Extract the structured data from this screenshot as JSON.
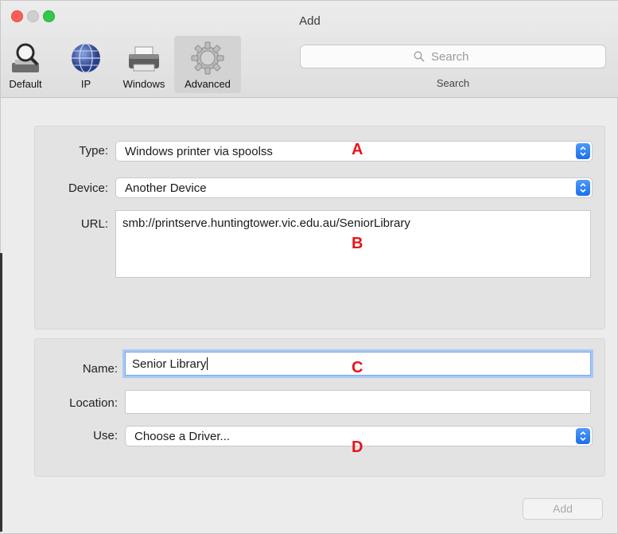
{
  "window": {
    "title": "Add"
  },
  "toolbar": {
    "tools": [
      {
        "label": "Default",
        "icon": "magnifier-printer-icon"
      },
      {
        "label": "IP",
        "icon": "globe-icon"
      },
      {
        "label": "Windows",
        "icon": "printer-icon"
      },
      {
        "label": "Advanced",
        "icon": "gear-icon",
        "selected": true
      }
    ],
    "search": {
      "placeholder": "Search",
      "label": "Search"
    }
  },
  "advanced": {
    "type": {
      "label": "Type:",
      "value": "Windows printer via spoolss"
    },
    "device": {
      "label": "Device:",
      "value": "Another Device"
    },
    "url": {
      "label": "URL:",
      "value": "smb://printserve.huntingtower.vic.edu.au/SeniorLibrary"
    }
  },
  "details": {
    "name": {
      "label": "Name:",
      "value": "Senior Library"
    },
    "location": {
      "label": "Location:",
      "value": ""
    },
    "use": {
      "label": "Use:",
      "value": "Choose a Driver..."
    }
  },
  "annotations": {
    "a": "A",
    "b": "B",
    "c": "C",
    "d": "D"
  },
  "footer": {
    "add_label": "Add"
  },
  "colors": {
    "accent": "#1b6ff0",
    "annotation": "#e8121a"
  }
}
